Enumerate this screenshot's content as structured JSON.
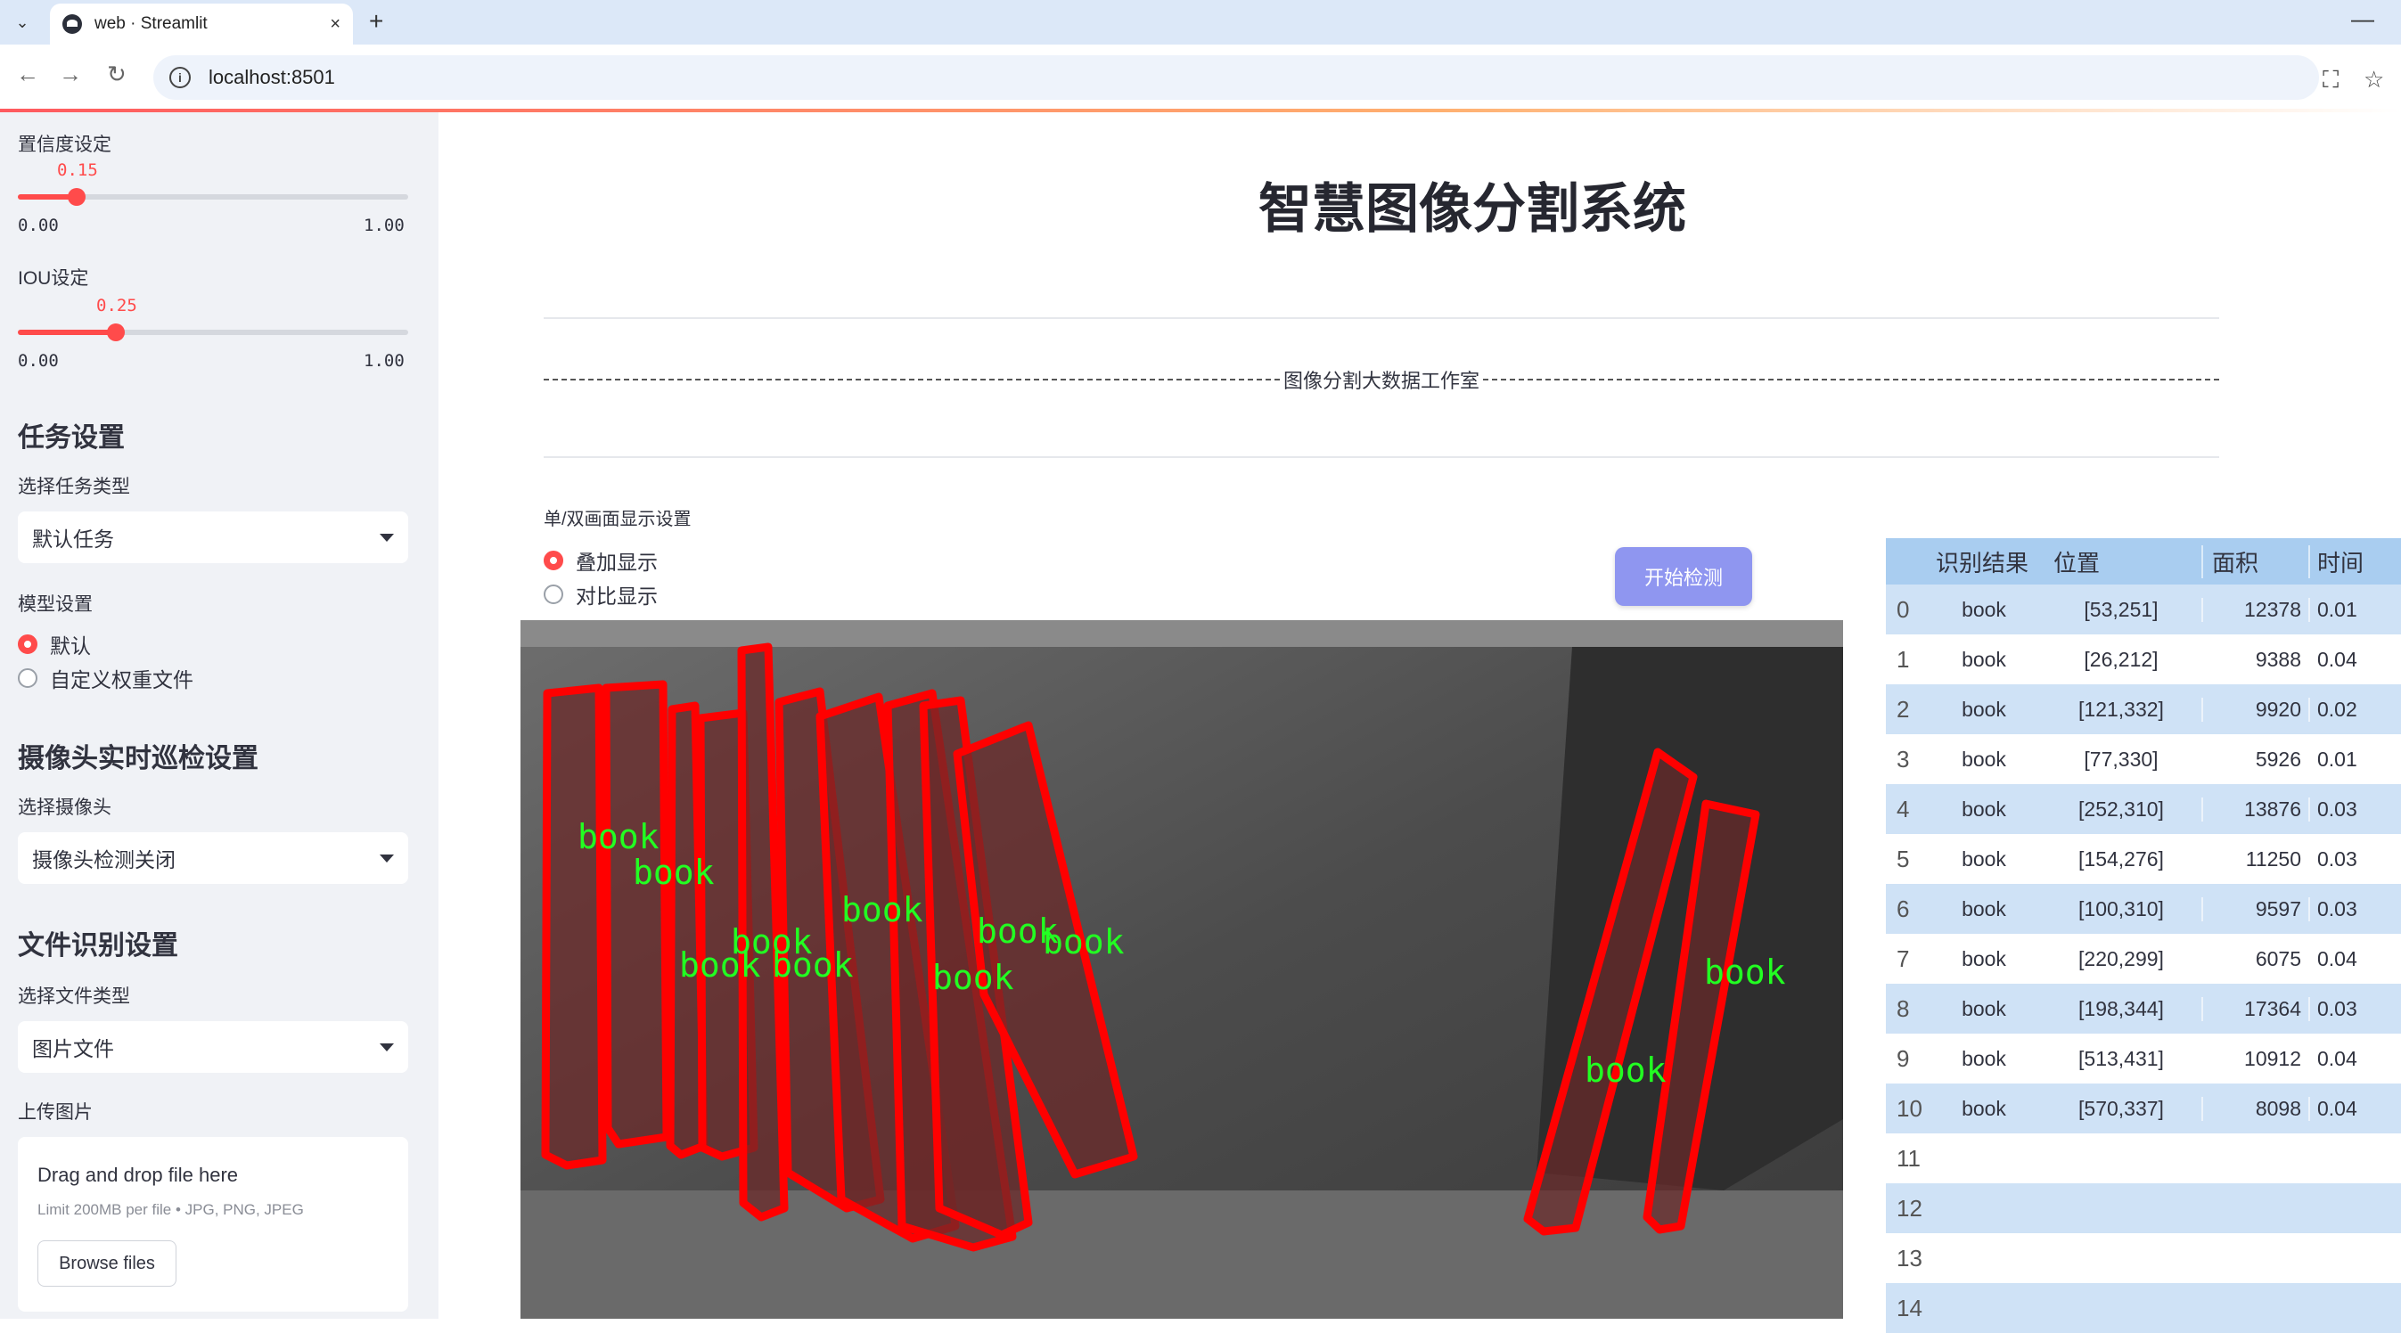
{
  "browser": {
    "tab_title": "web · Streamlit",
    "url": "localhost:8501",
    "new_tab_glyph": "+",
    "close_glyph": "×"
  },
  "sidebar": {
    "confidence": {
      "label": "置信度设定",
      "value": "0.15",
      "level": 0.15,
      "min": "0.00",
      "max": "1.00"
    },
    "iou": {
      "label": "IOU设定",
      "value": "0.25",
      "level": 0.25,
      "min": "0.00",
      "max": "1.00"
    },
    "task_section": "任务设置",
    "task_type_label": "选择任务类型",
    "task_type_value": "默认任务",
    "model_label": "模型设置",
    "model_options": [
      "默认",
      "自定义权重文件"
    ],
    "camera_section": "摄像头实时巡检设置",
    "camera_label": "选择摄像头",
    "camera_value": "摄像头检测关闭",
    "file_section": "文件识别设置",
    "file_type_label": "选择文件类型",
    "file_type_value": "图片文件",
    "upload_label": "上传图片",
    "upload_title": "Drag and drop file here",
    "upload_limit": "Limit 200MB per file • JPG, PNG, JPEG",
    "browse_label": "Browse files"
  },
  "main": {
    "title": "智慧图像分割系统",
    "banner": "图像分割大数据工作室",
    "display_label": "单/双画面显示设置",
    "display_options": [
      "叠加显示",
      "对比显示"
    ],
    "start_button": "开始检测",
    "detection_label": "book"
  },
  "table": {
    "headers": [
      "识别结果",
      "位置",
      "面积",
      "时间"
    ],
    "rows": [
      {
        "idx": "0",
        "cls": "book",
        "pos": "[53,251]",
        "area": "12378",
        "time": "0.01"
      },
      {
        "idx": "1",
        "cls": "book",
        "pos": "[26,212]",
        "area": "9388",
        "time": "0.04"
      },
      {
        "idx": "2",
        "cls": "book",
        "pos": "[121,332]",
        "area": "9920",
        "time": "0.02"
      },
      {
        "idx": "3",
        "cls": "book",
        "pos": "[77,330]",
        "area": "5926",
        "time": "0.01"
      },
      {
        "idx": "4",
        "cls": "book",
        "pos": "[252,310]",
        "area": "13876",
        "time": "0.03"
      },
      {
        "idx": "5",
        "cls": "book",
        "pos": "[154,276]",
        "area": "11250",
        "time": "0.03"
      },
      {
        "idx": "6",
        "cls": "book",
        "pos": "[100,310]",
        "area": "9597",
        "time": "0.03"
      },
      {
        "idx": "7",
        "cls": "book",
        "pos": "[220,299]",
        "area": "6075",
        "time": "0.04"
      },
      {
        "idx": "8",
        "cls": "book",
        "pos": "[198,344]",
        "area": "17364",
        "time": "0.03"
      },
      {
        "idx": "9",
        "cls": "book",
        "pos": "[513,431]",
        "area": "10912",
        "time": "0.04"
      },
      {
        "idx": "10",
        "cls": "book",
        "pos": "[570,337]",
        "area": "8098",
        "time": "0.04"
      },
      {
        "idx": "11",
        "cls": "",
        "pos": "",
        "area": "",
        "time": ""
      },
      {
        "idx": "12",
        "cls": "",
        "pos": "",
        "area": "",
        "time": ""
      },
      {
        "idx": "13",
        "cls": "",
        "pos": "",
        "area": "",
        "time": ""
      },
      {
        "idx": "14",
        "cls": "",
        "pos": "",
        "area": "",
        "time": ""
      }
    ]
  },
  "colors": {
    "accent": "#ff4b4b",
    "button": "#8f96f0",
    "table_header": "#a9cdf0",
    "table_stripe": "#cfe2f6",
    "mask_outline": "#ff0000",
    "label_text": "#22ff22"
  }
}
